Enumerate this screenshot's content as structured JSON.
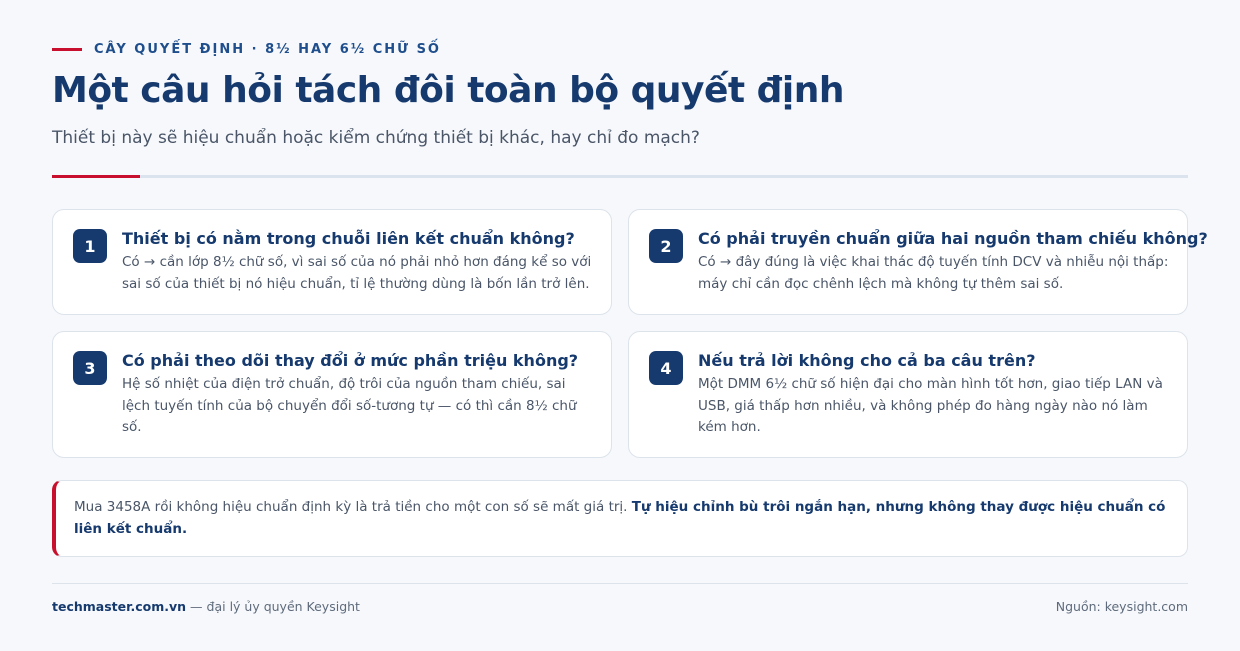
{
  "header": {
    "eyebrow": "CÂY QUYẾT ĐỊNH · 8½ HAY 6½ CHỮ SỐ",
    "title": "Một câu hỏi tách đôi toàn bộ quyết định",
    "subtitle": "Thiết bị này sẽ hiệu chuẩn hoặc kiểm chứng thiết bị khác, hay chỉ đo mạch?"
  },
  "cards": [
    {
      "number": "1",
      "question": "Thiết bị có nằm trong chuỗi liên kết chuẩn không?",
      "answer": "Có → cần lớp 8½ chữ số, vì sai số của nó phải nhỏ hơn đáng kể so với sai số của thiết bị nó hiệu chuẩn, tỉ lệ thường dùng là bốn lần trở lên."
    },
    {
      "number": "2",
      "question": "Có phải truyền chuẩn giữa hai nguồn tham chiếu không?",
      "answer": "Có → đây đúng là việc khai thác độ tuyến tính DCV và nhiễu nội thấp: máy chỉ cần đọc chênh lệch mà không tự thêm sai số."
    },
    {
      "number": "3",
      "question": "Có phải theo dõi thay đổi ở mức phần triệu không?",
      "answer": "Hệ số nhiệt của điện trở chuẩn, độ trôi của nguồn tham chiếu, sai lệch tuyến tính của bộ chuyển đổi số-tương tự — có thì cần 8½ chữ số."
    },
    {
      "number": "4",
      "question": "Nếu trả lời không cho cả ba câu trên?",
      "answer": "Một DMM 6½ chữ số hiện đại cho màn hình tốt hơn, giao tiếp LAN và USB, giá thấp hơn nhiều, và không phép đo hàng ngày nào nó làm kém hơn."
    }
  ],
  "callout": {
    "text": "Mua 3458A rồi không hiệu chuẩn định kỳ là trả tiền cho một con số sẽ mất giá trị. ",
    "emphasis": "Tự hiệu chỉnh bù trôi ngắn hạn, nhưng không thay được hiệu chuẩn có liên kết chuẩn."
  },
  "footer": {
    "site": "techmaster.com.vn",
    "tagline": " — đại lý ủy quyền Keysight",
    "source": "Nguồn: keysight.com"
  },
  "colors": {
    "accent": "#c8102e",
    "navy": "#163a6e",
    "background": "#f6f8fb"
  }
}
